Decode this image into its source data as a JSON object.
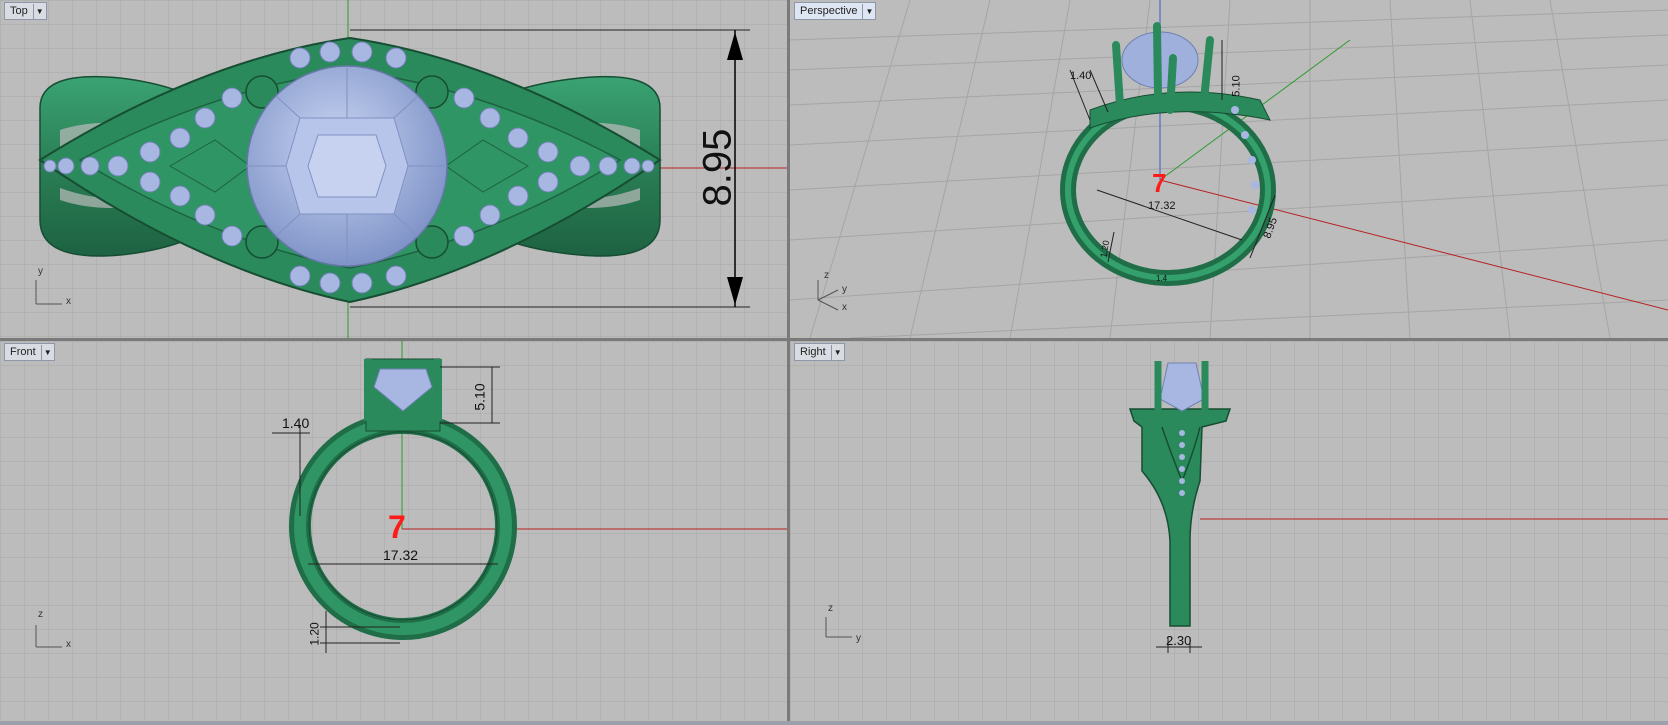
{
  "viewports": {
    "top": {
      "label": "Top",
      "dimension": "8.95",
      "axis_a": "y",
      "axis_b": "x"
    },
    "perspective": {
      "label": "Perspective",
      "dim_height": "5.10",
      "dim_width": "1.40",
      "dim_inner": "17.32",
      "dim_band": "8.95",
      "dim_bottom": "1.20",
      "dim_small": "1.4",
      "ring_size": "7",
      "axis_a": "z",
      "axis_b": "y",
      "axis_c": "x"
    },
    "front": {
      "label": "Front",
      "dim_height": "5.10",
      "dim_width": "1.40",
      "dim_inner": "17.32",
      "dim_bottom": "1.20",
      "ring_size": "7",
      "axis_a": "z",
      "axis_b": "x"
    },
    "right": {
      "label": "Right",
      "dim_width": "2.30",
      "axis_a": "z",
      "axis_b": "y"
    }
  },
  "colors": {
    "viewport_bg": "#bcbcbc",
    "grid_minor": "#a9a9a9",
    "grid_major": "#8f8f8f",
    "axis_x": "#b72020",
    "axis_y": "#2f9a2f",
    "axis_z": "#3a5ad0",
    "metal": "#2c8a5d",
    "metal_dark": "#1a5c3c",
    "gem": "#a9b9e3",
    "ring_size": "#ff1a1a"
  }
}
